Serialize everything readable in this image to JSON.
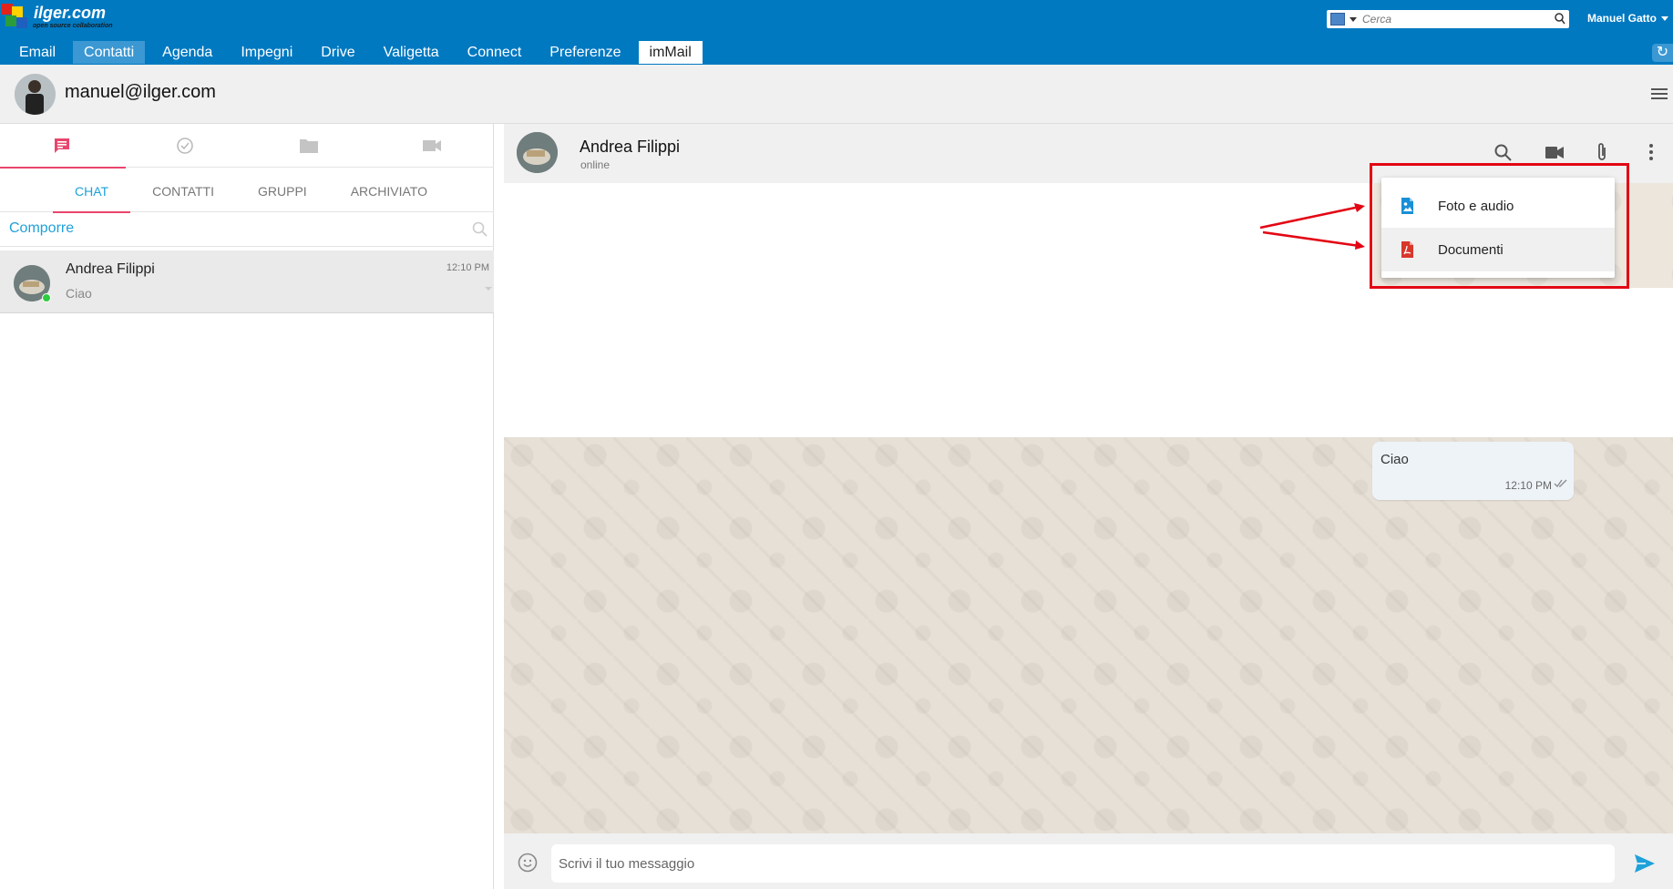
{
  "header": {
    "logo_text": "ilger.com",
    "logo_subtext": "open source collaboration",
    "search_placeholder": "Cerca",
    "user_name": "Manuel Gatto",
    "nav": [
      {
        "label": "Email"
      },
      {
        "label": "Contatti"
      },
      {
        "label": "Agenda"
      },
      {
        "label": "Impegni"
      },
      {
        "label": "Drive"
      },
      {
        "label": "Valigetta"
      },
      {
        "label": "Connect"
      },
      {
        "label": "Preferenze"
      },
      {
        "label": "imMail"
      }
    ],
    "refresh_icon": "↻"
  },
  "account": {
    "email": "manuel@ilger.com"
  },
  "sidebar": {
    "icon_tabs": [
      "chat-icon",
      "check-circle-icon",
      "folder-icon",
      "video-icon"
    ],
    "tabs": [
      {
        "label": "CHAT"
      },
      {
        "label": "CONTATTI"
      },
      {
        "label": "GRUPPI"
      },
      {
        "label": "ARCHIVIATO"
      }
    ],
    "compose_label": "Comporre",
    "chats": [
      {
        "name": "Andrea Filippi",
        "time": "12:10 PM",
        "preview": "Ciao",
        "online": true
      }
    ]
  },
  "conversation": {
    "name": "Andrea Filippi",
    "status": "online",
    "messages": [
      {
        "text": "Ciao",
        "time": "12:10 PM"
      }
    ],
    "input_placeholder": "Scrivi il tuo messaggio"
  },
  "attach_menu": {
    "items": [
      {
        "label": "Foto e audio",
        "icon": "image-file-icon"
      },
      {
        "label": "Documenti",
        "icon": "pdf-file-icon"
      }
    ]
  },
  "colors": {
    "header_blue": "#0079c1",
    "accent_pink": "#e9456d",
    "accent_cyan": "#1fa1d9",
    "highlight_red": "#e30613"
  }
}
